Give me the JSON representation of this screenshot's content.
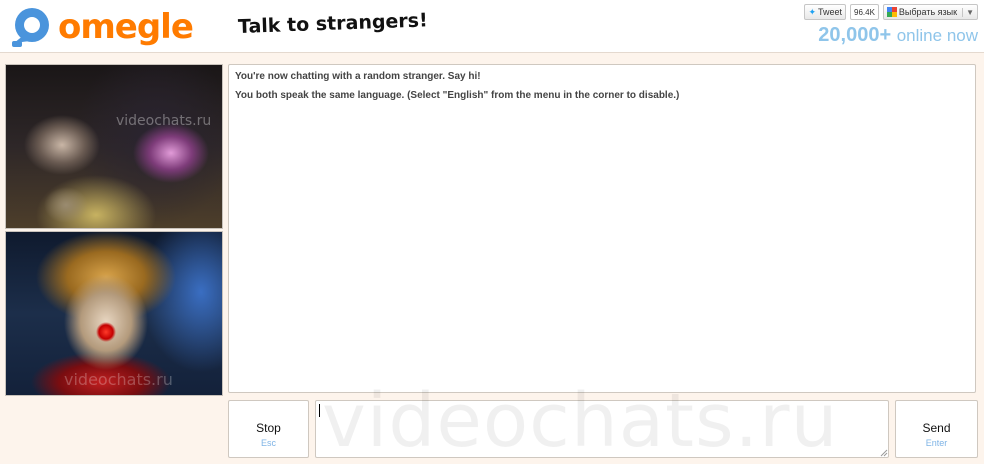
{
  "header": {
    "logo_text": "omegle",
    "tagline": "Talk to strangers!",
    "social": {
      "tweet_label": "Tweet",
      "tweet_count": "96.4K",
      "translate_label": "Выбрать язык"
    },
    "online": {
      "count": "20,000+",
      "label": "online now"
    }
  },
  "videos": {
    "stranger_watermark": "videochats.ru",
    "self_watermark": "videochats.ru"
  },
  "chat": {
    "messages": [
      "You're now chatting with a random stranger. Say hi!",
      "You both speak the same language. (Select \"English\" from the menu in the corner to disable.)"
    ]
  },
  "controls": {
    "stop_label": "Stop",
    "stop_hint": "Esc",
    "send_label": "Send",
    "send_hint": "Enter",
    "message_value": ""
  },
  "page_watermark": "videochats.ru",
  "colors": {
    "brand": "#ff7b00",
    "logo_blue": "#4a94dc",
    "online": "#8fc5ea",
    "hint": "#7fb4e6",
    "background": "#fdf4ec"
  }
}
